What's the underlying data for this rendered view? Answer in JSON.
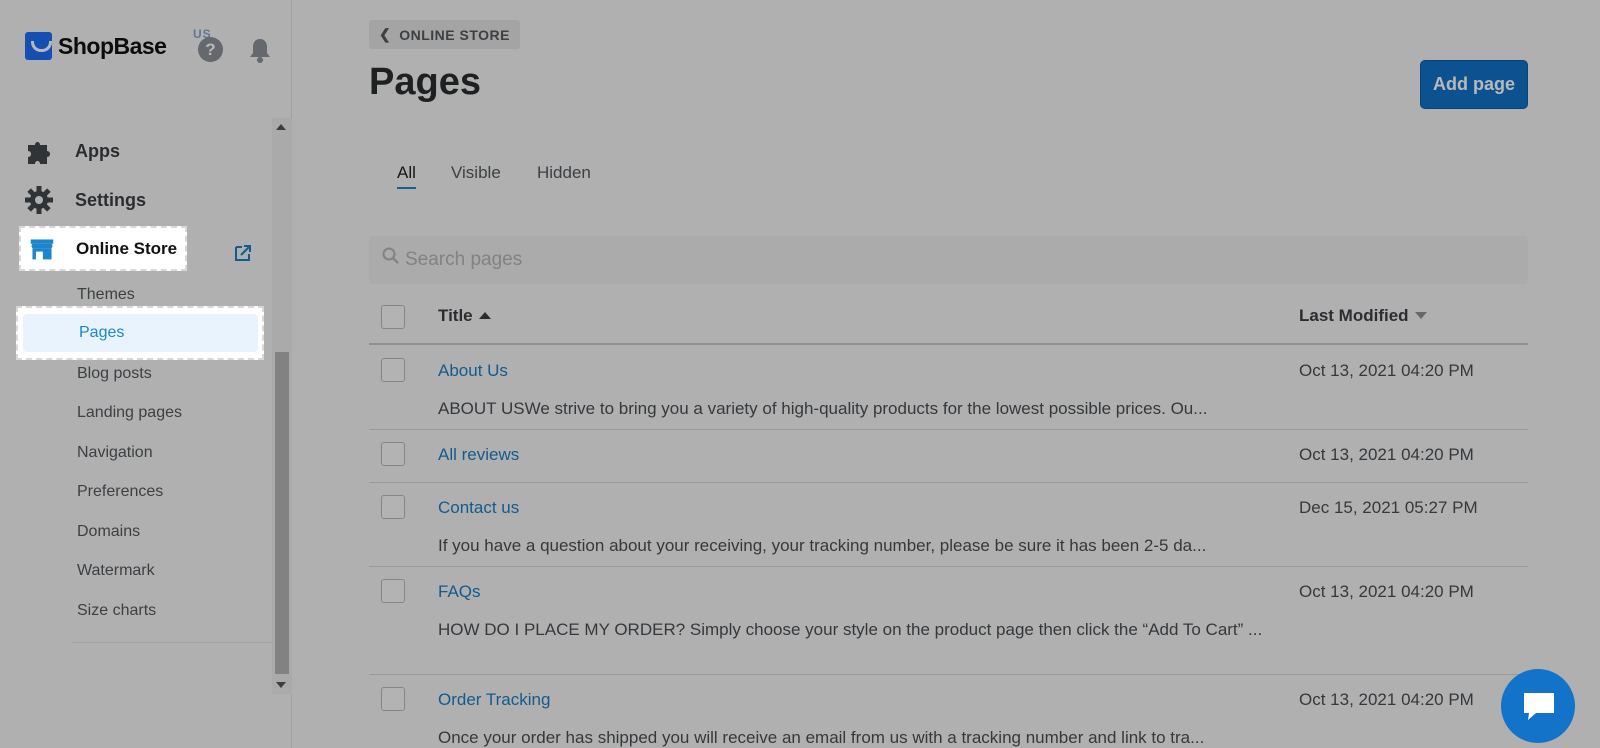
{
  "brand": {
    "name": "ShopBase",
    "region": "US"
  },
  "sidebar": {
    "main_items": [
      {
        "label": "Apps"
      },
      {
        "label": "Settings"
      },
      {
        "label": "Online Store"
      }
    ],
    "sub_items": [
      {
        "label": "Themes"
      },
      {
        "label": "Pages"
      },
      {
        "label": "Blog posts"
      },
      {
        "label": "Landing pages"
      },
      {
        "label": "Navigation"
      },
      {
        "label": "Preferences"
      },
      {
        "label": "Domains"
      },
      {
        "label": "Watermark"
      },
      {
        "label": "Size charts"
      }
    ]
  },
  "header": {
    "breadcrumb": "ONLINE STORE",
    "title": "Pages",
    "add_label": "Add page"
  },
  "tabs": [
    {
      "label": "All"
    },
    {
      "label": "Visible"
    },
    {
      "label": "Hidden"
    }
  ],
  "search": {
    "placeholder": "Search pages"
  },
  "table": {
    "columns": {
      "title": "Title",
      "modified": "Last Modified"
    },
    "rows": [
      {
        "title": "About Us",
        "date": "Oct 13, 2021 04:20 PM",
        "desc": "ABOUT USWe strive to bring you a variety of high-quality products for the lowest possible prices. Ou..."
      },
      {
        "title": "All reviews",
        "date": "Oct 13, 2021 04:20 PM",
        "desc": ""
      },
      {
        "title": "Contact us",
        "date": "Dec 15, 2021 05:27 PM",
        "desc": "If you have a question about your receiving, your tracking number, please be sure it has been 2-5 da..."
      },
      {
        "title": "FAQs",
        "date": "Oct 13, 2021 04:20 PM",
        "desc": "HOW DO I PLACE MY ORDER?  Simply choose your style on the product page then click the “Add To Cart” ..."
      },
      {
        "title": "Order Tracking",
        "date": "Oct 13, 2021 04:20 PM",
        "desc": "Once your order has shipped you will receive an email from us with a tracking number and link to tra..."
      }
    ]
  },
  "colors": {
    "accent": "#1172c9",
    "link": "#1b7fc2",
    "overlay": "rgba(0,0,0,0.28)"
  }
}
